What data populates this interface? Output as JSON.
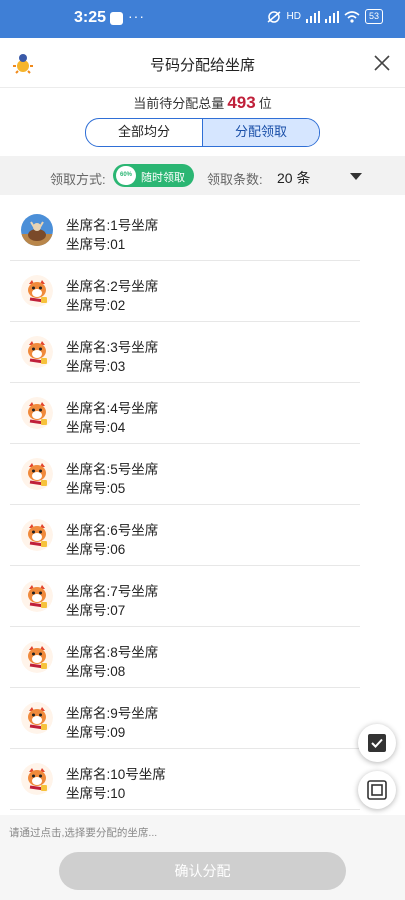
{
  "status_bar": {
    "time": "3:25",
    "dots": "···",
    "signal_label": "HD",
    "battery": "53"
  },
  "header": {
    "title": "号码分配给坐席"
  },
  "summary": {
    "prefix": "当前待分配总量",
    "count": "493",
    "suffix": "位"
  },
  "segmented": {
    "options": [
      "全部均分",
      "分配领取"
    ],
    "active_index": 1
  },
  "filter": {
    "mode_label": "领取方式:",
    "toggle_knob": "60%",
    "toggle_text": "随时领取",
    "count_label": "领取条数:",
    "count_value": "20 条"
  },
  "seats": [
    {
      "name_label": "坐席名:",
      "name": "1号坐席",
      "id_label": "坐席号:",
      "id": "01",
      "avatar": "photo-avatar-icon"
    },
    {
      "name_label": "坐席名:",
      "name": "2号坐席",
      "id_label": "坐席号:",
      "id": "02",
      "avatar": "tiger-avatar-icon"
    },
    {
      "name_label": "坐席名:",
      "name": "3号坐席",
      "id_label": "坐席号:",
      "id": "03",
      "avatar": "tiger-avatar-icon"
    },
    {
      "name_label": "坐席名:",
      "name": "4号坐席",
      "id_label": "坐席号:",
      "id": "04",
      "avatar": "tiger-avatar-icon"
    },
    {
      "name_label": "坐席名:",
      "name": "5号坐席",
      "id_label": "坐席号:",
      "id": "05",
      "avatar": "tiger-avatar-icon"
    },
    {
      "name_label": "坐席名:",
      "name": "6号坐席",
      "id_label": "坐席号:",
      "id": "06",
      "avatar": "tiger-avatar-icon"
    },
    {
      "name_label": "坐席名:",
      "name": "7号坐席",
      "id_label": "坐席号:",
      "id": "07",
      "avatar": "tiger-avatar-icon"
    },
    {
      "name_label": "坐席名:",
      "name": "8号坐席",
      "id_label": "坐席号:",
      "id": "08",
      "avatar": "tiger-avatar-icon"
    },
    {
      "name_label": "坐席名:",
      "name": "9号坐席",
      "id_label": "坐席号:",
      "id": "09",
      "avatar": "tiger-avatar-icon"
    },
    {
      "name_label": "坐席名:",
      "name": "10号坐席",
      "id_label": "坐席号:",
      "id": "10",
      "avatar": "tiger-avatar-icon"
    }
  ],
  "fabs": {
    "select_all": "check-icon",
    "deselect": "square-icon"
  },
  "footer": {
    "hint": "请通过点击,选择要分配的坐席...",
    "confirm_label": "确认分配"
  },
  "colors": {
    "status_bar": "#3f7fd6",
    "accent": "#2f6fd6",
    "count": "#c0203a",
    "toggle": "#2bb673",
    "disabled_button": "#cfcfcf"
  }
}
